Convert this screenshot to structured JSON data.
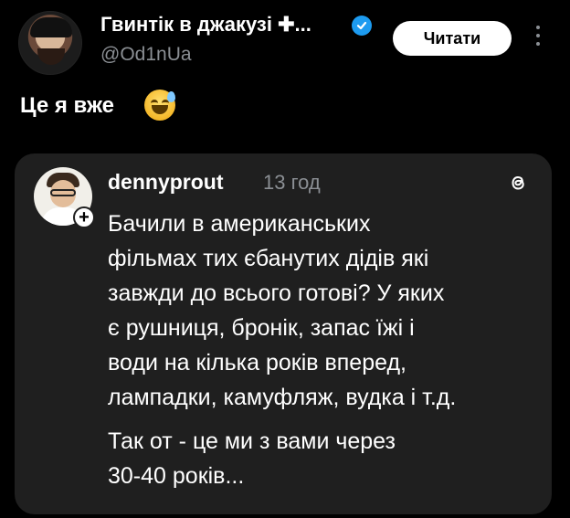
{
  "header": {
    "display_name": "Гвинтік в джакузі ✚...",
    "handle": "@Od1nUa",
    "follow_label": "Читати"
  },
  "post": {
    "text": "Це я вже"
  },
  "quoted": {
    "username": "dennyprout",
    "time": "13 год",
    "paragraph_1": "Бачили в американських\nфільмах тих єбанутих дідів які\nзавжди до всього готові? У яких\nє рушниця, бронік, запас їжі і\nводи на кілька років вперед,\nлампадки, камуфляж, вудка і т.д.",
    "paragraph_2": "Так от - це ми з вами через\n30-40 років..."
  },
  "icons": {
    "verified": "verified-badge-icon",
    "more": "more-vertical-icon",
    "emoji": "grinning-sweat-emoji",
    "follow_plus": "plus-icon",
    "threads": "threads-logo-icon"
  },
  "colors": {
    "background": "#000000",
    "card": "#1f1f1f",
    "verified": "#1d9bf0",
    "muted_text": "#8b8f94"
  }
}
